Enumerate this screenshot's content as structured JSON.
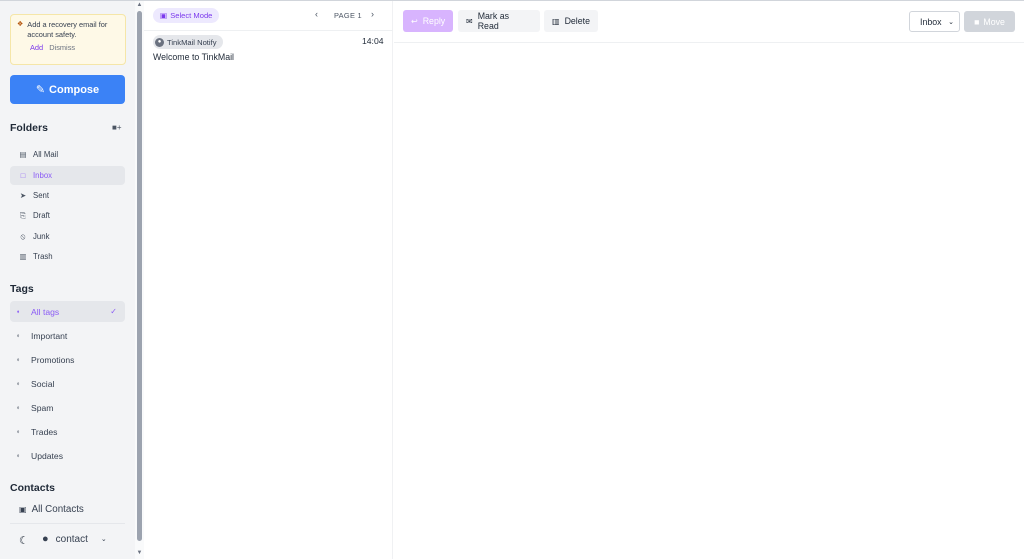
{
  "notice": {
    "icon": "shield-icon",
    "text": "Add a recovery email for account safety.",
    "add_label": "Add",
    "dismiss_label": "Dismiss"
  },
  "compose": {
    "label": "Compose",
    "icon": "pencil-icon"
  },
  "folders": {
    "heading": "Folders",
    "add_icon": "folder-plus-icon",
    "items": [
      {
        "label": "All Mail",
        "icon": "mail-stack-icon",
        "active": false
      },
      {
        "label": "Inbox",
        "icon": "inbox-icon",
        "active": true
      },
      {
        "label": "Sent",
        "icon": "send-icon",
        "active": false
      },
      {
        "label": "Draft",
        "icon": "draft-icon",
        "active": false
      },
      {
        "label": "Junk",
        "icon": "junk-icon",
        "active": false
      },
      {
        "label": "Trash",
        "icon": "trash-icon",
        "active": false
      }
    ]
  },
  "tags": {
    "heading": "Tags",
    "items": [
      {
        "label": "All tags",
        "active": true
      },
      {
        "label": "Important",
        "active": false
      },
      {
        "label": "Promotions",
        "active": false
      },
      {
        "label": "Social",
        "active": false
      },
      {
        "label": "Spam",
        "active": false
      },
      {
        "label": "Trades",
        "active": false
      },
      {
        "label": "Updates",
        "active": false
      }
    ]
  },
  "contacts": {
    "heading": "Contacts",
    "all_label": "All Contacts"
  },
  "footer": {
    "user_label": "contact",
    "theme_icon": "moon-icon"
  },
  "list": {
    "select_mode_label": "Select Mode",
    "page_label": "PAGE 1",
    "messages": [
      {
        "sender": "TinkMail Notify",
        "time": "14:04",
        "subject": "Welcome to TinkMail"
      }
    ]
  },
  "toolbar": {
    "reply_label": "Reply",
    "mark_read_label": "Mark as Read",
    "delete_label": "Delete",
    "folder_select_value": "Inbox",
    "move_label": "Move"
  },
  "colors": {
    "accent": "#8b5cf6",
    "compose_bg": "#3b82f6",
    "sidebar_bg": "#f3f4f6",
    "notice_bg": "#fef9e7"
  }
}
